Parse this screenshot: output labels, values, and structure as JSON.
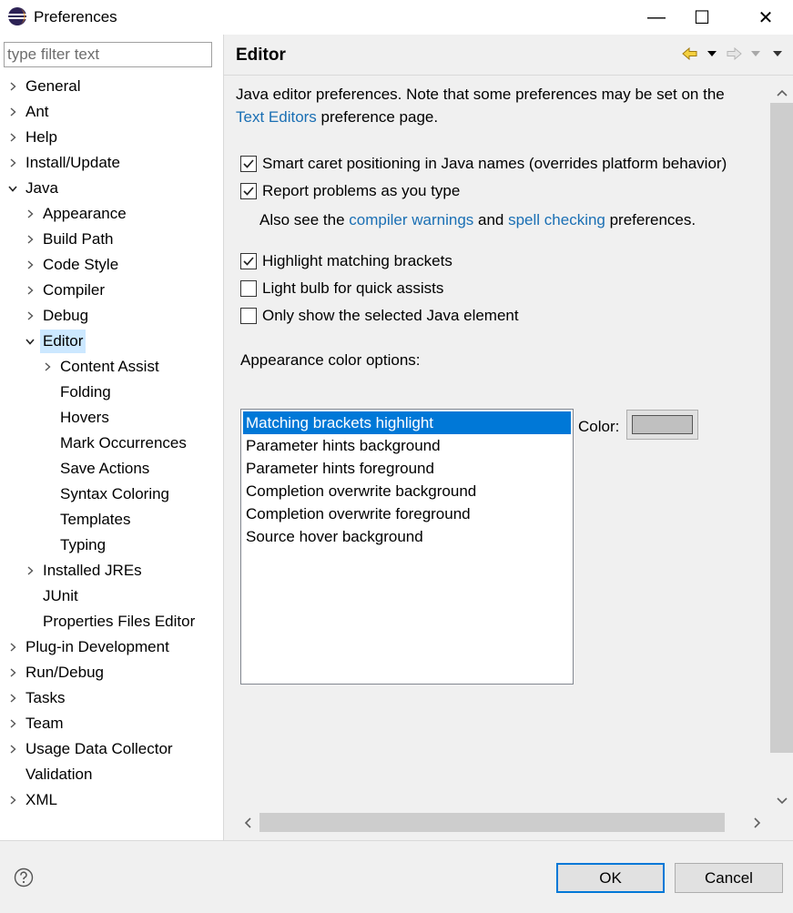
{
  "window": {
    "title": "Preferences",
    "minimize_glyph": "—",
    "maximize_glyph": "☐",
    "close_glyph": "✕"
  },
  "filter": {
    "placeholder": "type filter text",
    "value": ""
  },
  "tree": [
    {
      "label": "General",
      "level": 0,
      "expander": "collapsed"
    },
    {
      "label": "Ant",
      "level": 0,
      "expander": "collapsed"
    },
    {
      "label": "Help",
      "level": 0,
      "expander": "collapsed"
    },
    {
      "label": "Install/Update",
      "level": 0,
      "expander": "collapsed"
    },
    {
      "label": "Java",
      "level": 0,
      "expander": "expanded"
    },
    {
      "label": "Appearance",
      "level": 1,
      "expander": "collapsed"
    },
    {
      "label": "Build Path",
      "level": 1,
      "expander": "collapsed"
    },
    {
      "label": "Code Style",
      "level": 1,
      "expander": "collapsed"
    },
    {
      "label": "Compiler",
      "level": 1,
      "expander": "collapsed"
    },
    {
      "label": "Debug",
      "level": 1,
      "expander": "collapsed"
    },
    {
      "label": "Editor",
      "level": 1,
      "expander": "expanded",
      "selected": true
    },
    {
      "label": "Content Assist",
      "level": 2,
      "expander": "collapsed"
    },
    {
      "label": "Folding",
      "level": 2,
      "expander": "none"
    },
    {
      "label": "Hovers",
      "level": 2,
      "expander": "none"
    },
    {
      "label": "Mark Occurrences",
      "level": 2,
      "expander": "none"
    },
    {
      "label": "Save Actions",
      "level": 2,
      "expander": "none"
    },
    {
      "label": "Syntax Coloring",
      "level": 2,
      "expander": "none"
    },
    {
      "label": "Templates",
      "level": 2,
      "expander": "none"
    },
    {
      "label": "Typing",
      "level": 2,
      "expander": "none"
    },
    {
      "label": "Installed JREs",
      "level": 1,
      "expander": "collapsed"
    },
    {
      "label": "JUnit",
      "level": 1,
      "expander": "none"
    },
    {
      "label": "Properties Files Editor",
      "level": 1,
      "expander": "none"
    },
    {
      "label": "Plug-in Development",
      "level": 0,
      "expander": "collapsed"
    },
    {
      "label": "Run/Debug",
      "level": 0,
      "expander": "collapsed"
    },
    {
      "label": "Tasks",
      "level": 0,
      "expander": "collapsed"
    },
    {
      "label": "Team",
      "level": 0,
      "expander": "collapsed"
    },
    {
      "label": "Usage Data Collector",
      "level": 0,
      "expander": "collapsed"
    },
    {
      "label": "Validation",
      "level": 0,
      "expander": "none"
    },
    {
      "label": "XML",
      "level": 0,
      "expander": "collapsed"
    }
  ],
  "page": {
    "title": "Editor",
    "intro_line1": "Java editor preferences. Note that some preferences may be set on the",
    "intro_link": "Text Editors",
    "intro_line2_rest": " preference page.",
    "checkboxes": [
      {
        "label": "Smart caret positioning in Java names (overrides platform behavior)",
        "checked": true
      },
      {
        "label": "Report problems as you type",
        "checked": true
      },
      {
        "label": "Highlight matching brackets",
        "checked": true
      },
      {
        "label": "Light bulb for quick assists",
        "checked": false
      },
      {
        "label": "Only show the selected Java element",
        "checked": false
      }
    ],
    "also_see_prefix": "Also see the ",
    "also_see_link1": "compiler warnings",
    "also_see_mid": " and ",
    "also_see_link2": "spell checking",
    "also_see_suffix": " preferences.",
    "appearance_label": "Appearance color options:",
    "color_options": [
      {
        "label": "Matching brackets highlight",
        "selected": true
      },
      {
        "label": "Parameter hints background",
        "selected": false
      },
      {
        "label": "Parameter hints foreground",
        "selected": false
      },
      {
        "label": "Completion overwrite background",
        "selected": false
      },
      {
        "label": "Completion overwrite foreground",
        "selected": false
      },
      {
        "label": "Source hover background",
        "selected": false
      }
    ],
    "color_label": "Color:",
    "color_value": "#c0c0c0"
  },
  "buttons": {
    "ok": "OK",
    "cancel": "Cancel"
  }
}
